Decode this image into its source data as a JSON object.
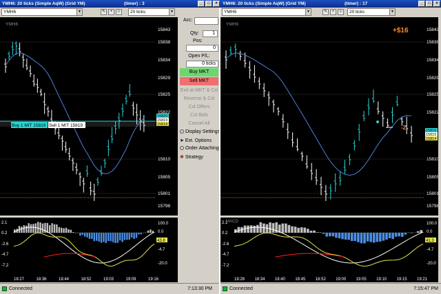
{
  "left": {
    "title": "YMH6: 20 ticks (Simple AqW) (Grid YM)",
    "timer": "(timer) : 3",
    "interval": "20 ticks",
    "symbol": "YMH6",
    "price_labels": [
      "15843",
      "15838",
      "15834",
      "15829",
      "15825",
      "15822",
      "15810",
      "15805",
      "15801",
      "15798"
    ],
    "highlight_prices": [
      "15820",
      "15819",
      "15818"
    ],
    "order_bar": {
      "buy": "Buy 1 MIT 15819",
      "sell": "Sell 1 MIT 15819"
    },
    "ind_labels": [
      "100.0",
      "0.0",
      "-20.0"
    ],
    "ind_values": [
      "43.8",
      "-4.7"
    ],
    "ind_left_labels": [
      "2.1",
      "0.2",
      "-2.6",
      "-4.7",
      "-7.2"
    ],
    "times": [
      "18:27",
      "18:36",
      "18:44",
      "18:52",
      "19:03",
      "19:09",
      "19:16"
    ],
    "status": "Connected",
    "clock": "7:13:30 PM"
  },
  "right": {
    "title": "YMH6: 20 ticks (Simple AqW) (Grid YM)",
    "timer": "(timer) : 17",
    "interval": "20 ticks",
    "symbol": "YMH6",
    "pnl": "+$16",
    "position_marker": "-2",
    "price_labels": [
      "15843",
      "15838",
      "15834",
      "15829",
      "15825",
      "15822",
      "15810",
      "15805",
      "15801",
      "15798"
    ],
    "highlight_prices": [
      "15816",
      "15815",
      "15814"
    ],
    "ind_top_label": "MACD",
    "ind_labels": [
      "100.0",
      "0.0",
      "-20.0"
    ],
    "ind_values": [
      "41.3",
      "-4.7"
    ],
    "ind_left_labels": [
      "2.1",
      "0.2",
      "-2.6",
      "-4.7",
      "-7.2"
    ],
    "times": [
      "18:28",
      "18:34",
      "18:40",
      "18:45",
      "18:52",
      "19:00",
      "19:05",
      "19:10",
      "19:15",
      "19:21"
    ],
    "status": "Connected",
    "clock": "7:15:47 PM"
  },
  "panel": {
    "acc_label": "Acc:",
    "acc_value": "",
    "qty_label": "Qty:",
    "qty_value": "1",
    "pos_label": "Pos:",
    "pos_value": "0",
    "open_pl_label": "Open P/L:",
    "open_pl_value": "0 ticks",
    "buy_mkt": "Buy MKT",
    "sell_mkt": "Sell MKT",
    "exit": "Exit at MKT & Cxl",
    "reverse": "Reverse & Cxl",
    "cxl_offers": "Cxl Offers",
    "cxl_bids": "Cxl Bids",
    "cancel_all": "Cancel All",
    "display_settings": "Display Settings",
    "ext_options": "Ext. Options",
    "order_attaching": "Order Attaching",
    "strategy": "Strategy"
  },
  "colors": {
    "candle": "#ffffff",
    "candle_up": "#29d6d6",
    "ma": "#4f7fd8",
    "pnl": "#ff8a2a",
    "hist_neg": "#4a8fe6",
    "hist_pos": "#bfbfbf",
    "macd_line": "#ffffff",
    "signal_line": "#e6e64a",
    "red_line": "#ff2020"
  }
}
